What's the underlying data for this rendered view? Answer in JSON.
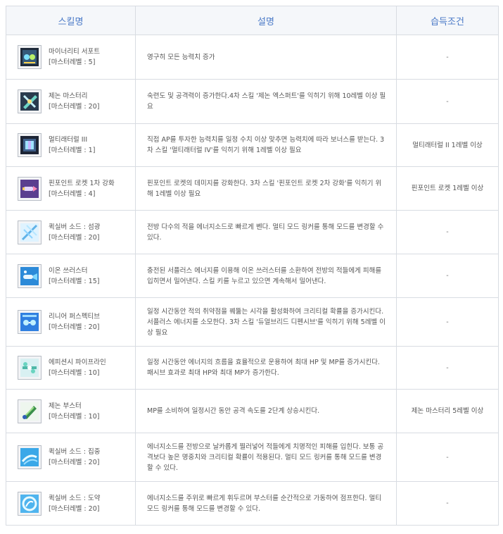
{
  "header": {
    "skill": "스킬명",
    "description": "설명",
    "condition": "습득조건"
  },
  "rows": [
    {
      "icon": "minority-support-icon",
      "name": "마이너리티 서포트",
      "level": "[마스터레벨 : 5]",
      "desc": "영구히 모든 능력치 증가",
      "cond": "-"
    },
    {
      "icon": "xenon-mastery-icon",
      "name": "제논 마스터리",
      "level": "[마스터레벨 : 20]",
      "desc": "숙련도 및 공격력이 증가한다.4차 스킬 '제논 엑스퍼트'를 익히기 위해 10레벨 이상 필요",
      "cond": "-"
    },
    {
      "icon": "multilateral-3-icon",
      "name": "멀티래터럴 III",
      "level": "[마스터레벨 : 1]",
      "desc": "직접 AP를 투자한 능력치를 일정 수치 이상 맞추면 능력치에 따라 보너스를 받는다. 3차 스킬 '멀티래터럴 IV'를 익히기 위해 1레벨 이상 필요",
      "cond": "멀티래터럴 II 1레벨 이상"
    },
    {
      "icon": "pinpoint-rocket-icon",
      "name": "핀포인트 로켓 1차 강화",
      "level": "[마스터레벨 : 4]",
      "desc": "핀포인트 로켓의 데미지를 강화한다. 3차 스킬 '핀포인트 로켓 2차 강화'를 익히기 위해 1레벨 이상 필요",
      "cond": "핀포인트 로켓 1레벨 이상"
    },
    {
      "icon": "quicksilver-sword-flash-icon",
      "name": "퀵실버 소드 : 섬광",
      "level": "[마스터레벨 : 20]",
      "desc": "전방 다수의 적을 에너지소드로 빠르게 벤다. 멀티 모드 링커를 통해 모드를 변경할 수 있다.",
      "cond": "-"
    },
    {
      "icon": "ion-thruster-icon",
      "name": "이온 쓰러스터",
      "level": "[마스터레벨 : 15]",
      "desc": "충전된 서플러스 에너지를 이용해 이온 쓰러스터를 소환하여 전방의 적들에게 피해를 입히면서 밀어낸다. 스킬 키를 누르고 있으면 계속해서 밀어낸다.",
      "cond": "-"
    },
    {
      "icon": "linear-perspective-icon",
      "name": "리니어 퍼스펙티브",
      "level": "[마스터레벨 : 20]",
      "desc": "일정 시간동안 적의 취약점을 꿰뚫는 시각을 활성화하여 크리티컬 확률을 증가시킨다. 서플러스 에너지를 소모한다. 3차 스킬 '듀얼브리드 디펜시브'를 익히기 위해 5레벨 이상 필요",
      "cond": "-"
    },
    {
      "icon": "efficiency-pipeline-icon",
      "name": "에피션시 파이프라인",
      "level": "[마스터레벨 : 10]",
      "desc": "일정 시간동안 에너지의 흐름을 효율적으로 운용하여 최대 HP 및 MP를 증가시킨다. 패시브 효과로 최대 HP와 최대 MP가 증가한다.",
      "cond": "-"
    },
    {
      "icon": "xenon-booster-icon",
      "name": "제논 부스터",
      "level": "[마스터레벨 : 10]",
      "desc": "MP를 소비하여 일정시간 동안 공격 속도를 2단계 상승시킨다.",
      "cond": "제논 마스터리 5레벨 이상"
    },
    {
      "icon": "quicksilver-sword-focus-icon",
      "name": "퀵실버 소드 : 집중",
      "level": "[마스터레벨 : 20]",
      "desc": "에너지소드를 전방으로 날카롭게 찔러넣어 적들에게 치명적인 피해를 입힌다. 보통 공격보다 높은 명중치와 크리티컬 확률이 적용된다. 멀티 모드 링커를 통해 모드를 변경할 수 있다.",
      "cond": "-"
    },
    {
      "icon": "quicksilver-sword-leap-icon",
      "name": "퀵실버 소드 : 도약",
      "level": "[마스터레벨 : 20]",
      "desc": "에너지소드를 주위로 빠르게 휘두르며 부스터를 순간적으로 가동하여 점프한다. 멀티 모드 링커를 통해 모드를 변경할 수 있다.",
      "cond": "-"
    }
  ]
}
